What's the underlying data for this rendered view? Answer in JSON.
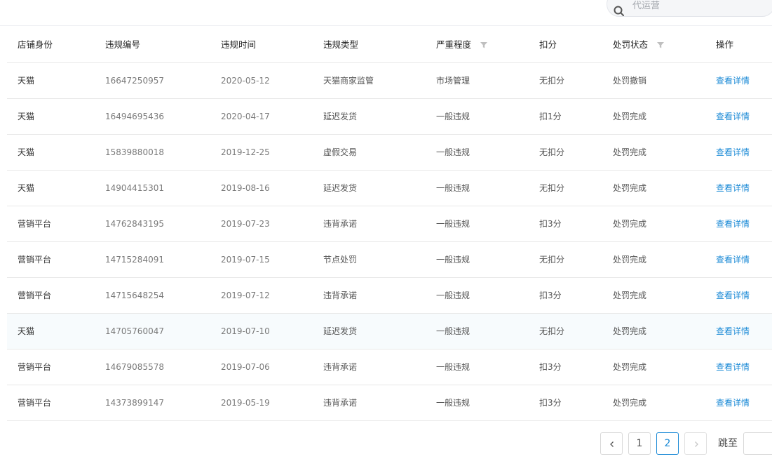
{
  "search": {
    "placeholder": "代运营",
    "icon": "search-icon"
  },
  "table": {
    "headers": [
      "店铺身份",
      "违规编号",
      "违规时间",
      "违规类型",
      "严重程度",
      "扣分",
      "处罚状态",
      "操作"
    ],
    "filter_columns": [
      "严重程度",
      "处罚状态"
    ],
    "rows": [
      [
        "天猫",
        "16647250957",
        "2020-05-12",
        "天猫商家监管",
        "市场管理",
        "无扣分",
        "处罚撤销",
        "查看详情"
      ],
      [
        "天猫",
        "16494695436",
        "2020-04-17",
        "延迟发货",
        "一般违规",
        "扣1分",
        "处罚完成",
        "查看详情"
      ],
      [
        "天猫",
        "15839880018",
        "2019-12-25",
        "虚假交易",
        "一般违规",
        "无扣分",
        "处罚完成",
        "查看详情"
      ],
      [
        "天猫",
        "14904415301",
        "2019-08-16",
        "延迟发货",
        "一般违规",
        "无扣分",
        "处罚完成",
        "查看详情"
      ],
      [
        "营销平台",
        "14762843195",
        "2019-07-23",
        "违背承诺",
        "一般违规",
        "扣3分",
        "处罚完成",
        "查看详情"
      ],
      [
        "营销平台",
        "14715284091",
        "2019-07-15",
        "节点处罚",
        "一般违规",
        "无扣分",
        "处罚完成",
        "查看详情"
      ],
      [
        "营销平台",
        "14715648254",
        "2019-07-12",
        "违背承诺",
        "一般违规",
        "扣3分",
        "处罚完成",
        "查看详情"
      ],
      [
        "天猫",
        "14705760047",
        "2019-07-10",
        "延迟发货",
        "一般违规",
        "无扣分",
        "处罚完成",
        "查看详情"
      ],
      [
        "营销平台",
        "14679085578",
        "2019-07-06",
        "违背承诺",
        "一般违规",
        "扣3分",
        "处罚完成",
        "查看详情"
      ],
      [
        "营销平台",
        "14373899147",
        "2019-05-19",
        "违背承诺",
        "一般违规",
        "扣3分",
        "处罚完成",
        "查看详情"
      ]
    ],
    "highlighted_row": 7
  },
  "pagination": {
    "pages": [
      "1",
      "2"
    ],
    "current": "2",
    "jump_label": "跳至",
    "jump_value": ""
  },
  "colors": {
    "link": "#1b8ad6",
    "border": "#e8e8e8",
    "hover_row": "#f7fbfd"
  }
}
